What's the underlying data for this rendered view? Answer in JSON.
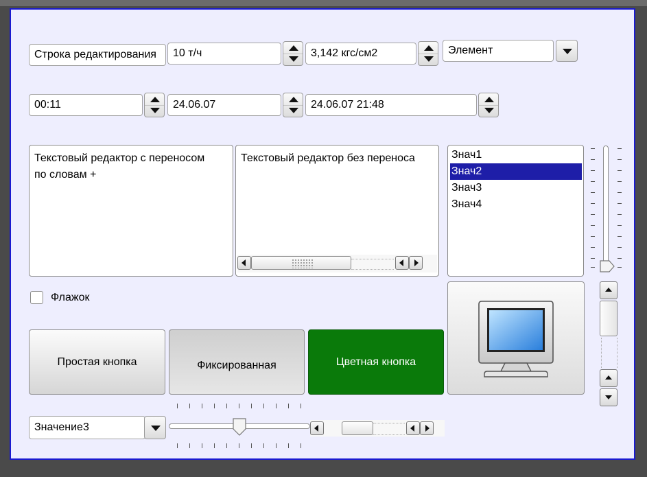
{
  "row1": {
    "edit_line": "Строка редактирования",
    "spin_rate": "10 т/ч",
    "spin_pressure": "3,142 кгс/см2",
    "combo_element": "Элемент"
  },
  "row2": {
    "time": "00:11",
    "date": "24.06.07",
    "datetime": "24.06.07 21:48"
  },
  "text_wrap": "Текстовый редактор с переносом по словам +",
  "text_nowrap": "Текстовый редактор без переноса",
  "listbox": {
    "items": [
      "Знач1",
      "Знач2",
      "Знач3",
      "Знач4"
    ],
    "selected_index": 1
  },
  "checkbox": {
    "label": "Флажок",
    "checked": false
  },
  "buttons": {
    "simple": "Простая кнопка",
    "fixed": "Фиксированная",
    "colored": "Цветная кнопка"
  },
  "bottom_combo": "Значение3",
  "colors": {
    "panel_bg": "#eeeefe",
    "panel_border": "#1a1ad0",
    "selection": "#1e1ea8",
    "colored_button": "#0a7a0a"
  },
  "sliders": {
    "horizontal_value": 0.5,
    "vertical_value": 0.95
  }
}
